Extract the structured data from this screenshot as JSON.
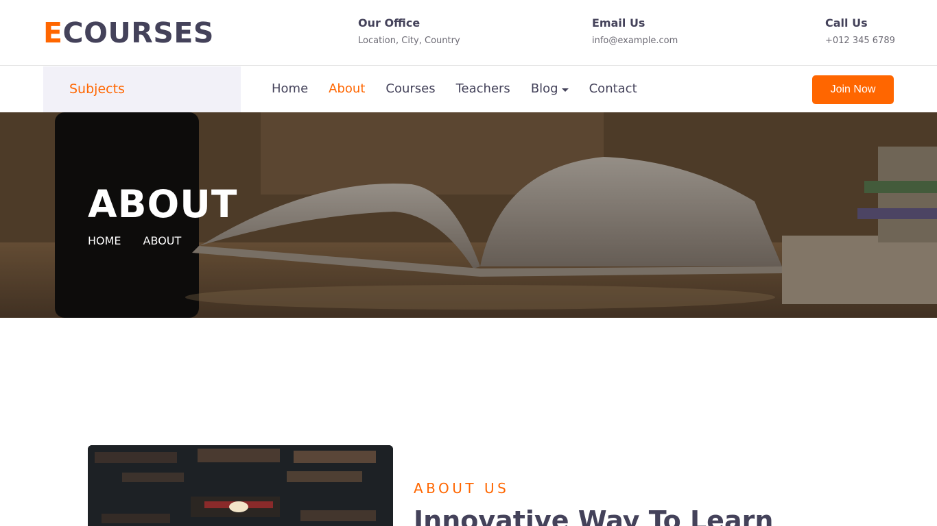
{
  "brand": {
    "first": "E",
    "rest": "COURSES"
  },
  "header": {
    "office": {
      "title": "Our Office",
      "value": "Location, City, Country"
    },
    "email": {
      "title": "Email Us",
      "value": "info@example.com"
    },
    "call": {
      "title": "Call Us",
      "value": "+012 345 6789"
    }
  },
  "nav": {
    "subjects": "Subjects",
    "items": [
      "Home",
      "About",
      "Courses",
      "Teachers",
      "Blog",
      "Contact"
    ],
    "active": "About",
    "join": "Join Now"
  },
  "hero": {
    "title": "ABOUT",
    "breadcrumb": [
      "HOME",
      "ABOUT"
    ]
  },
  "about": {
    "label": "ABOUT US",
    "title": "Innovative Way To Learn"
  },
  "colors": {
    "accent": "#ff6600",
    "text": "#44425a"
  }
}
